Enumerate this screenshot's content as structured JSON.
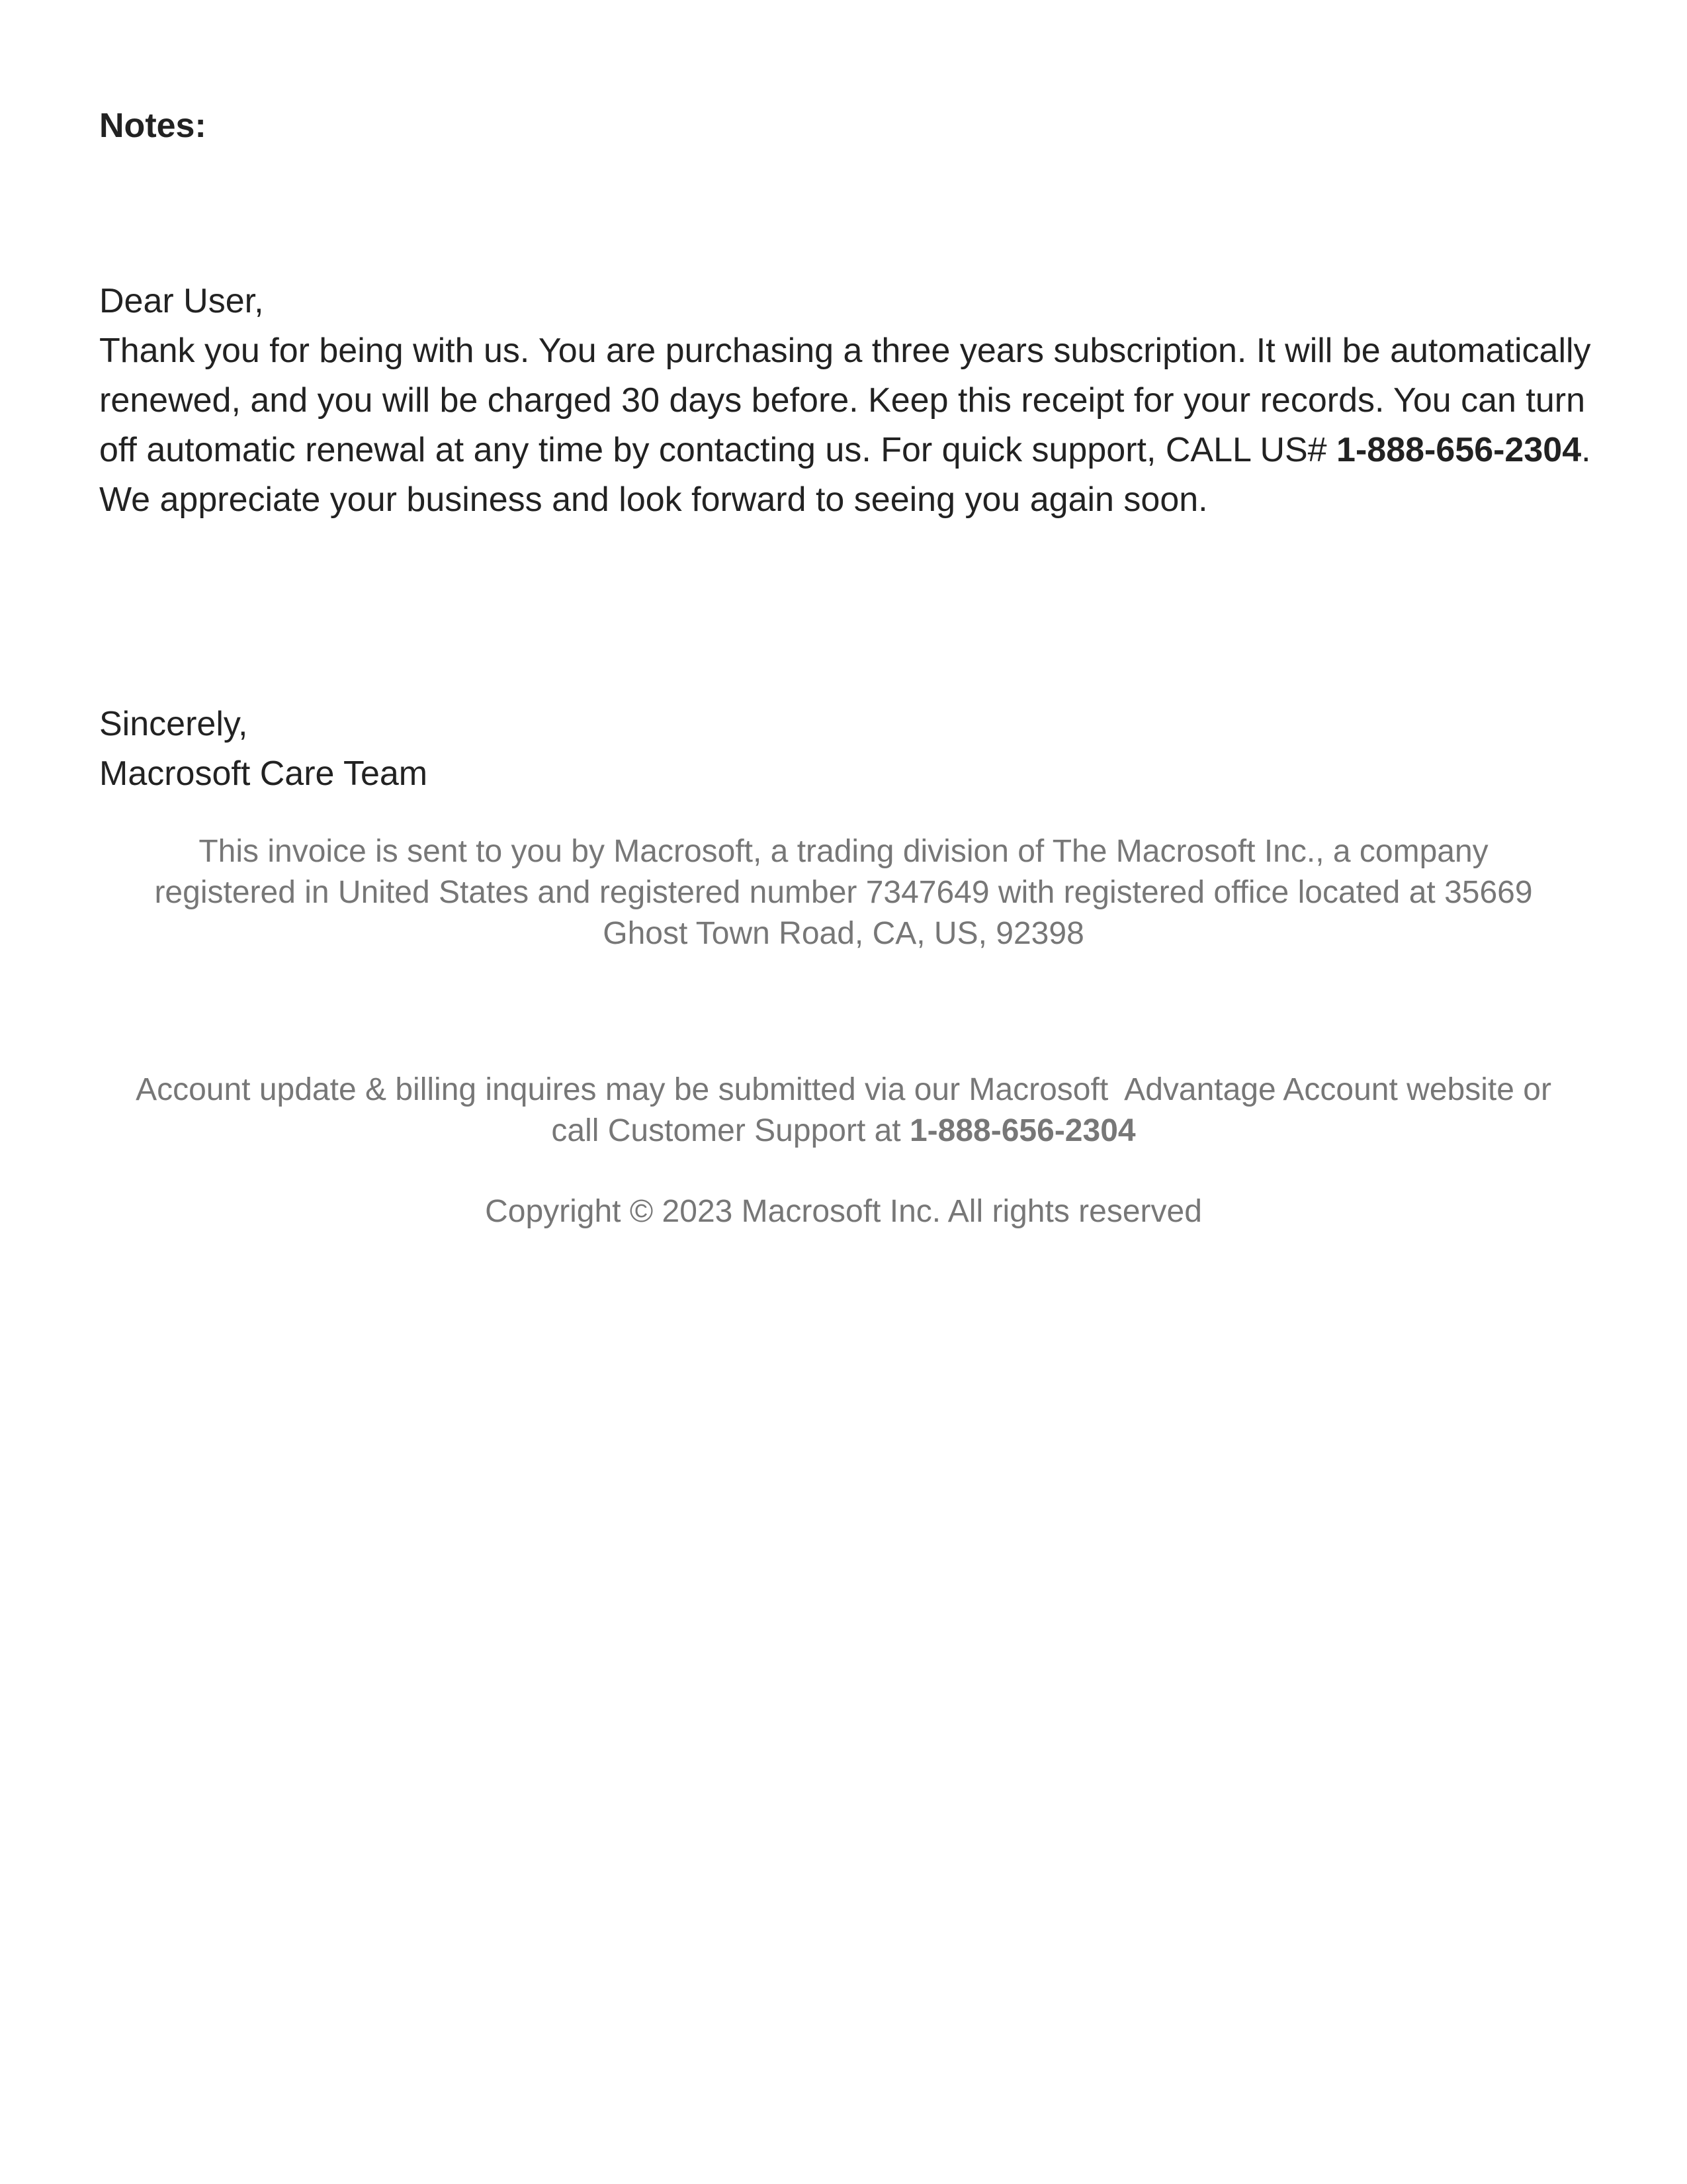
{
  "notes": {
    "heading": "Notes:"
  },
  "letter": {
    "salutation": "Dear User,",
    "body_before_phone": "Thank you for being with us. You are purchasing a three years subscription. It will be automatically renewed, and you will be charged 30 days before. Keep this receipt for your records. You can turn off automatic renewal at any time by contacting us. For quick support, CALL US# ",
    "phone": "1-888-656-2304",
    "body_after_phone": ". We appreciate your business and look forward to seeing you again soon."
  },
  "signoff": {
    "closing": "Sincerely,",
    "signature": "Macrosoft Care Team"
  },
  "footer": {
    "legal_line1": "This invoice is sent to you by Macrosoft, a trading division of The Macrosoft Inc., a company",
    "legal_line2": "registered in United States and registered number 7347649 with registered office located at 35669",
    "legal_line3": "Ghost Town Road, CA, US, 92398",
    "billing_line1": "Account update & billing inquires may be submitted via our Macrosoft  Advantage Account website or",
    "billing_line2_prefix": "call Customer Support at ",
    "billing_phone": "1-888-656-2304",
    "copyright": "Copyright © 2023 Macrosoft Inc. All rights reserved"
  },
  "colors": {
    "body_text": "#222222",
    "footer_text": "#777777",
    "background": "#ffffff"
  }
}
